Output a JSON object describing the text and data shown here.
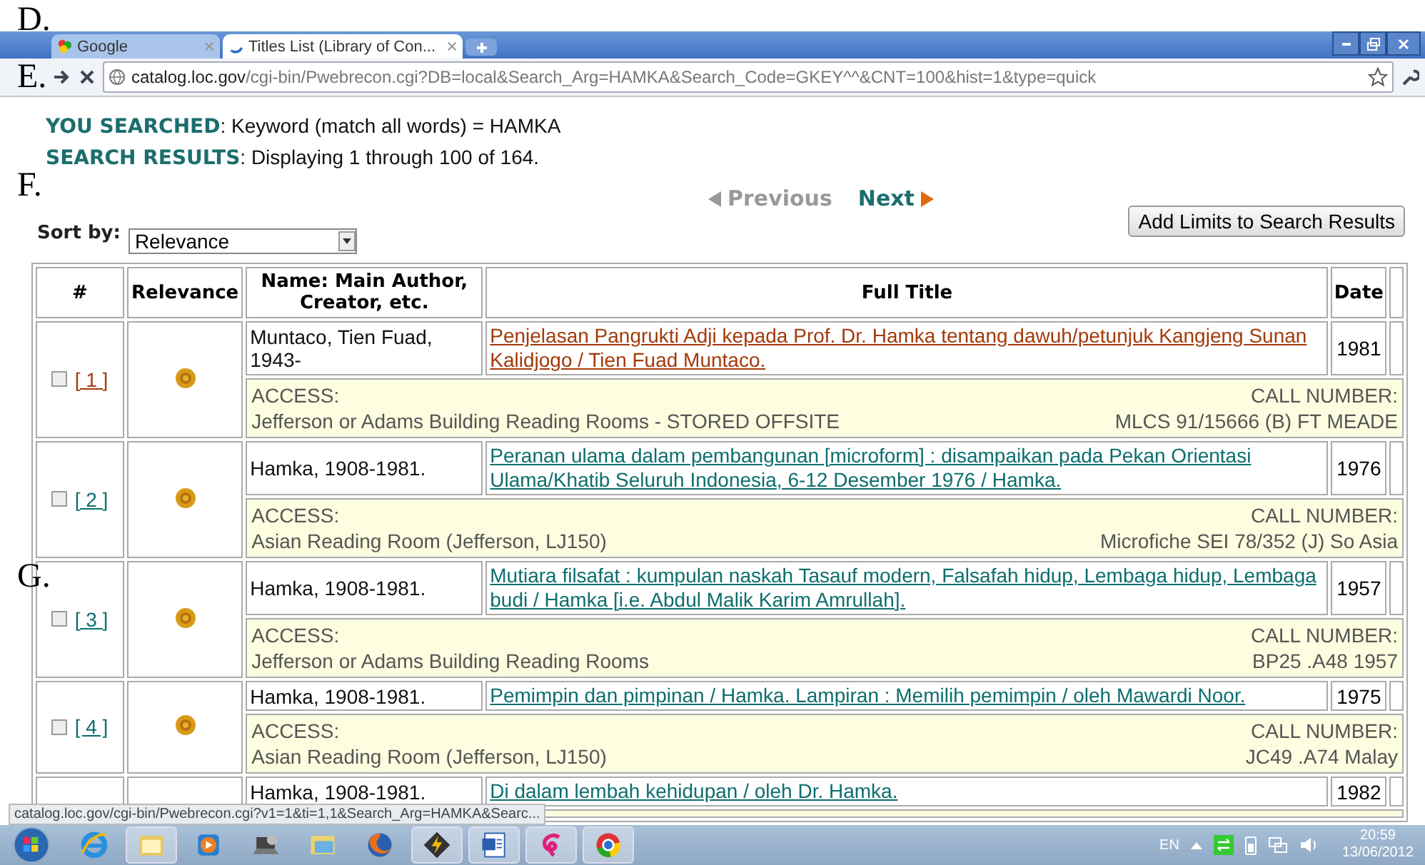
{
  "annotations": [
    {
      "label": "D."
    },
    {
      "label": "E."
    },
    {
      "label": "F."
    },
    {
      "label": "G."
    }
  ],
  "browser": {
    "tabs": [
      {
        "label": "Google",
        "selected": false
      },
      {
        "label": "Titles List (Library of Con...",
        "selected": true
      }
    ],
    "url_host": "catalog.loc.gov",
    "url_path": "/cgi-bin/Pwebrecon.cgi?DB=local&Search_Arg=HAMKA&Search_Code=GKEY^^&CNT=100&hist=1&type=quick"
  },
  "search": {
    "searched_label": "YOU SEARCHED",
    "searched_text": ": Keyword (match all words) = HAMKA",
    "results_label": "SEARCH RESULTS",
    "results_text": ": Displaying 1 through 100 of 164."
  },
  "pagination": {
    "previous": {
      "label": "Previous",
      "disabled": true
    },
    "next": {
      "label": "Next",
      "disabled": false
    }
  },
  "sort": {
    "label": "Sort by:",
    "value": "Relevance"
  },
  "limits_button": "Add Limits to Search Results",
  "table": {
    "columns": [
      "#",
      "Relevance",
      "Name: Main Author, Creator, etc.",
      "Full Title",
      "Date"
    ],
    "rows": [
      {
        "number": "[ 1 ]",
        "checked": false,
        "visited": true,
        "author": "Muntaco, Tien Fuad, 1943-",
        "title": "Penjelasan Pangrukti Adji kepada Prof. Dr. Hamka tentang dawuh/petunjuk Kangjeng Sunan Kalidjogo / Tien Fuad Muntaco.",
        "date": "1981",
        "access_label": "ACCESS:",
        "access": "Jefferson or Adams Building Reading Rooms - STORED OFFSITE",
        "call_label": "CALL NUMBER:",
        "call_number": "MLCS 91/15666 (B) FT MEADE"
      },
      {
        "number": "[ 2 ]",
        "checked": false,
        "visited": false,
        "author": "Hamka, 1908-1981.",
        "title": "Peranan ulama dalam pembangunan [microform] : disampaikan pada Pekan Orientasi Ulama/Khatib Seluruh Indonesia, 6-12 Desember 1976 / Hamka.",
        "date": "1976",
        "access_label": "ACCESS:",
        "access": "Asian Reading Room (Jefferson, LJ150)",
        "call_label": "CALL NUMBER:",
        "call_number": "Microfiche SEI 78/352 (J) So Asia"
      },
      {
        "number": "[ 3 ]",
        "checked": false,
        "visited": false,
        "author": "Hamka, 1908-1981.",
        "title": "Mutiara filsafat : kumpulan naskah Tasauf modern, Falsafah hidup, Lembaga hidup, Lembaga budi / Hamka [i.e. Abdul Malik Karim Amrullah].",
        "date": "1957",
        "access_label": "ACCESS:",
        "access": "Jefferson or Adams Building Reading Rooms",
        "call_label": "CALL NUMBER:",
        "call_number": "BP25 .A48 1957"
      },
      {
        "number": "[ 4 ]",
        "checked": false,
        "visited": false,
        "author": "Hamka, 1908-1981.",
        "title": "Pemimpin dan pimpinan / Hamka. Lampiran : Memilih pemimpin / oleh Mawardi Noor.",
        "date": "1975",
        "access_label": "ACCESS:",
        "access": "Asian Reading Room (Jefferson, LJ150)",
        "call_label": "CALL NUMBER:",
        "call_number": "JC49 .A74 Malay"
      },
      {
        "visited": false,
        "author": "Hamka, 1908-1981.",
        "title": "Di dalam lembah kehidupan / oleh Dr. Hamka.",
        "date": "1982"
      }
    ]
  },
  "status_bar": "catalog.loc.gov/cgi-bin/Pwebrecon.cgi?v1=1&ti=1,1&Search_Arg=HAMKA&Searc...",
  "taskbar": {
    "apps": [
      {
        "kind": "ie",
        "running": false
      },
      {
        "kind": "folder",
        "running": true
      },
      {
        "kind": "media",
        "running": false
      },
      {
        "kind": "laptop",
        "running": false
      },
      {
        "kind": "window",
        "running": false
      },
      {
        "kind": "firefox",
        "running": false
      },
      {
        "kind": "winamp",
        "running": true
      },
      {
        "kind": "word",
        "running": true
      },
      {
        "kind": "swirl",
        "running": true
      },
      {
        "kind": "chrome",
        "running": true
      }
    ],
    "language": "EN",
    "time": "20:59",
    "date": "13/06/2012"
  }
}
